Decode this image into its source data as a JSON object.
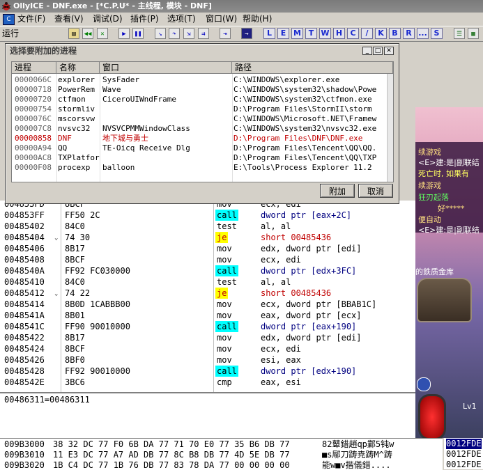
{
  "window": {
    "title": "OllyICE - DNF.exe - [*C.P.U* -  主线程, 模块 - DNF]"
  },
  "menu": [
    "文件(F)",
    "查看(V)",
    "调试(D)",
    "插件(P)",
    "选项(T)",
    "窗口(W)",
    "帮助(H)"
  ],
  "toolbar": {
    "status": "运行",
    "letters": [
      "L",
      "E",
      "M",
      "T",
      "W",
      "H",
      "C",
      "/",
      "K",
      "B",
      "R",
      "...",
      "S"
    ]
  },
  "dialog": {
    "title": "选择要附加的进程",
    "columns": [
      "进程",
      "名称",
      "窗口",
      "路径"
    ],
    "rows": [
      {
        "pid": "0000066C",
        "name": "explorer",
        "window": "SysFader",
        "path": "C:\\WINDOWS\\explorer.exe"
      },
      {
        "pid": "00000718",
        "name": "PowerRem",
        "window": "Wave",
        "path": "C:\\WINDOWS\\system32\\shadow\\Powe"
      },
      {
        "pid": "00000720",
        "name": "ctfmon",
        "window": "CiceroUIWndFrame",
        "path": "C:\\WINDOWS\\system32\\ctfmon.exe"
      },
      {
        "pid": "00000754",
        "name": "stormliv",
        "window": "",
        "path": "D:\\Program Files\\StormII\\storm"
      },
      {
        "pid": "0000076C",
        "name": "mscorsvw",
        "window": "",
        "path": "C:\\WINDOWS\\Microsoft.NET\\Framew"
      },
      {
        "pid": "000007C8",
        "name": "nvsvc32",
        "window": "NVSVCPMMWindowClass",
        "path": "C:\\WINDOWS\\system32\\nvsvc32.exe"
      },
      {
        "pid": "00000858",
        "name": "DNF",
        "window": "地下城与勇士",
        "path": "D:\\Program Files\\DNF\\DNF.exe",
        "highlight": true
      },
      {
        "pid": "00000A94",
        "name": "QQ",
        "window": "TE-Oicq Receive Dlg",
        "path": "D:\\Program Files\\Tencent\\QQ\\QQ."
      },
      {
        "pid": "00000AC8",
        "name": "TXPlatfor",
        "window": "",
        "path": "D:\\Program Files\\Tencent\\QQ\\TXP"
      },
      {
        "pid": "00000F08",
        "name": "procexp",
        "window": "balloon",
        "path": "E:\\Tools\\Process Explorer 11.2"
      }
    ],
    "attach_label": "附加",
    "cancel_label": "取消"
  },
  "disasm": [
    {
      "addr": "004853FD",
      "hex": "8BCF",
      "op": "mov",
      "arg": "ecx, edi"
    },
    {
      "addr": "004853FF",
      "hex": "FF50 2C",
      "op": "call",
      "arg": "dword ptr [eax+2C]"
    },
    {
      "addr": "00485402",
      "hex": "84C0",
      "op": "test",
      "arg": "al, al"
    },
    {
      "addr": "00485404",
      "hex": "74 30",
      "op": "je",
      "arg": "short 00485436"
    },
    {
      "addr": "00485406",
      "hex": "8B17",
      "op": "mov",
      "arg": "edx, dword ptr [edi]"
    },
    {
      "addr": "00485408",
      "hex": "8BCF",
      "op": "mov",
      "arg": "ecx, edi"
    },
    {
      "addr": "0048540A",
      "hex": "FF92 FC030000",
      "op": "call",
      "arg": "dword ptr [edx+3FC]"
    },
    {
      "addr": "00485410",
      "hex": "84C0",
      "op": "test",
      "arg": "al, al"
    },
    {
      "addr": "00485412",
      "hex": "74 22",
      "op": "je",
      "arg": "short 00485436"
    },
    {
      "addr": "00485414",
      "hex": "8B0D 1CABBB00",
      "op": "mov",
      "arg": "ecx, dword ptr [BBAB1C]"
    },
    {
      "addr": "0048541A",
      "hex": "8B01",
      "op": "mov",
      "arg": "eax, dword ptr [ecx]"
    },
    {
      "addr": "0048541C",
      "hex": "FF90 90010000",
      "op": "call",
      "arg": "dword ptr [eax+190]"
    },
    {
      "addr": "00485422",
      "hex": "8B17",
      "op": "mov",
      "arg": "edx, dword ptr [edi]"
    },
    {
      "addr": "00485424",
      "hex": "8BCF",
      "op": "mov",
      "arg": "ecx, edi"
    },
    {
      "addr": "00485426",
      "hex": "8BF0",
      "op": "mov",
      "arg": "esi, eax"
    },
    {
      "addr": "00485428",
      "hex": "FF92 90010000",
      "op": "call",
      "arg": "dword ptr [edx+190]"
    },
    {
      "addr": "0048542E",
      "hex": "3BC6",
      "op": "cmp",
      "arg": "eax, esi"
    }
  ],
  "info": "00486311=00486311",
  "dump": [
    {
      "addr": "009B3000",
      "hex": "38 32 DC 77  F0 6B DA 77  71 70 E0 77  35 B6 DB 77",
      "ascii": "82鼙錯趙qp鄴5钝w"
    },
    {
      "addr": "009B3010",
      "hex": "11 E3 DC 77  A7 AD DB 77  8C B8 DB 77  4D 5E DB 77",
      "ascii": "■s鄏刀踌尭踌M^踌"
    },
    {
      "addr": "009B3020",
      "hex": "1B C4 DC 77  1B 76 DB 77  83 78 DA 77  00 00 00 00",
      "ascii": "能w■v揩儀錯...."
    }
  ],
  "stack": [
    "0012FDE",
    "0012FDE",
    "0012FDE"
  ],
  "game": {
    "lines": [
      "续游戏",
      "<E>建:是|副联结",
      "死亡时, 如果有",
      "续游戏",
      "狂刃起落",
      "好*****",
      "便自动",
      "<E>建:是|副联结"
    ],
    "vault": "的鉄质金库",
    "level": "Lv1"
  }
}
